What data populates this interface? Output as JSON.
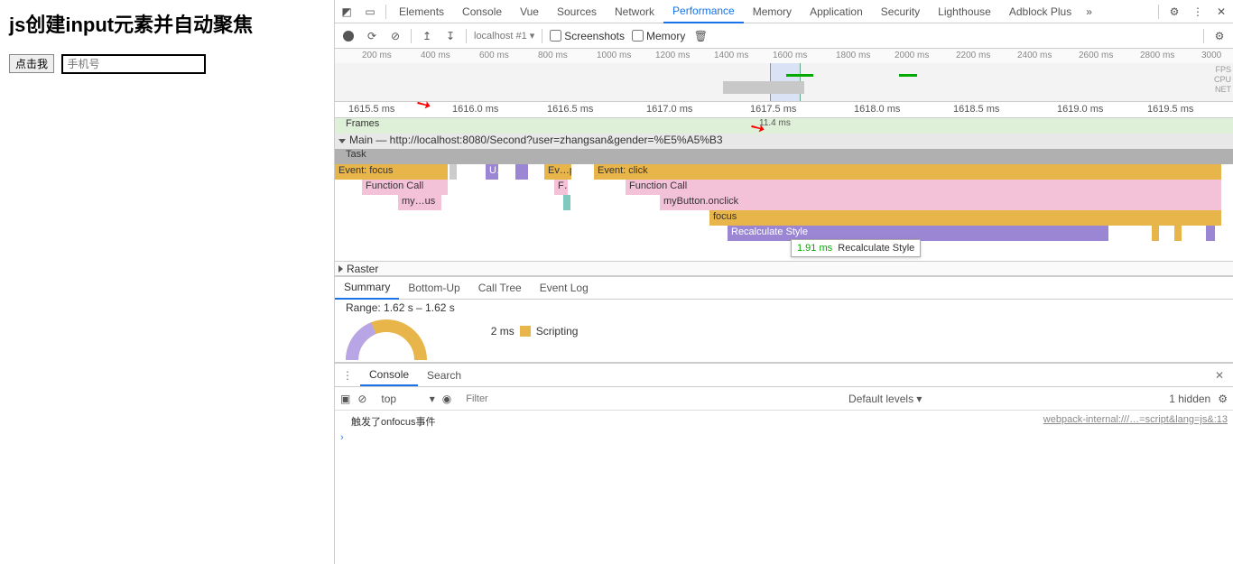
{
  "page": {
    "title": "js创建input元素并自动聚焦",
    "button": "点击我",
    "placeholder": "手机号"
  },
  "tabs": {
    "elements": "Elements",
    "console": "Console",
    "vue": "Vue",
    "sources": "Sources",
    "network": "Network",
    "performance": "Performance",
    "memory": "Memory",
    "application": "Application",
    "security": "Security",
    "lighthouse": "Lighthouse",
    "adblock": "Adblock Plus"
  },
  "toolbar": {
    "target": "localhost #1",
    "screenshots": "Screenshots",
    "memory": "Memory"
  },
  "overview_ticks": [
    "200 ms",
    "400 ms",
    "600 ms",
    "800 ms",
    "1000 ms",
    "1200 ms",
    "1400 ms",
    "1600 ms",
    "1800 ms",
    "2000 ms",
    "2200 ms",
    "2400 ms",
    "2600 ms",
    "2800 ms",
    "3000"
  ],
  "mini_labels": {
    "fps": "FPS",
    "cpu": "CPU",
    "net": "NET"
  },
  "ruler2": [
    "1615.5 ms",
    "1616.0 ms",
    "1616.5 ms",
    "1617.0 ms",
    "1617.5 ms",
    "1618.0 ms",
    "1618.5 ms",
    "1619.0 ms",
    "1619.5 ms"
  ],
  "flame": {
    "frames": "Frames",
    "frames_ms": "11.4 ms",
    "main": "Main — http://localhost:8080/Second?user=zhangsan&gender=%E5%A5%B3",
    "task": "Task",
    "focus": "Event: focus",
    "u": "U…",
    "evp": "Ev…p",
    "f": "F…",
    "click": "Event: click",
    "fcall": "Function Call",
    "mous": "my…us",
    "onclick": "myButton.onclick",
    "focus2": "focus",
    "recalc": "Recalculate Style",
    "raster": "Raster"
  },
  "tooltip": {
    "time": "1.91 ms",
    "label": "Recalculate Style"
  },
  "bottom_tabs": {
    "summary": "Summary",
    "bottomup": "Bottom-Up",
    "calltree": "Call Tree",
    "eventlog": "Event Log"
  },
  "summary": {
    "range": "Range: 1.62 s – 1.62 s",
    "legend_time": "2 ms",
    "legend_label": "Scripting"
  },
  "drawer": {
    "console": "Console",
    "search": "Search",
    "context": "top",
    "filter_ph": "Filter",
    "levels": "Default levels ▾",
    "hidden": "1 hidden",
    "log": "触发了onfocus事件",
    "src": "webpack-internal:///…=script&lang=js&:13"
  }
}
